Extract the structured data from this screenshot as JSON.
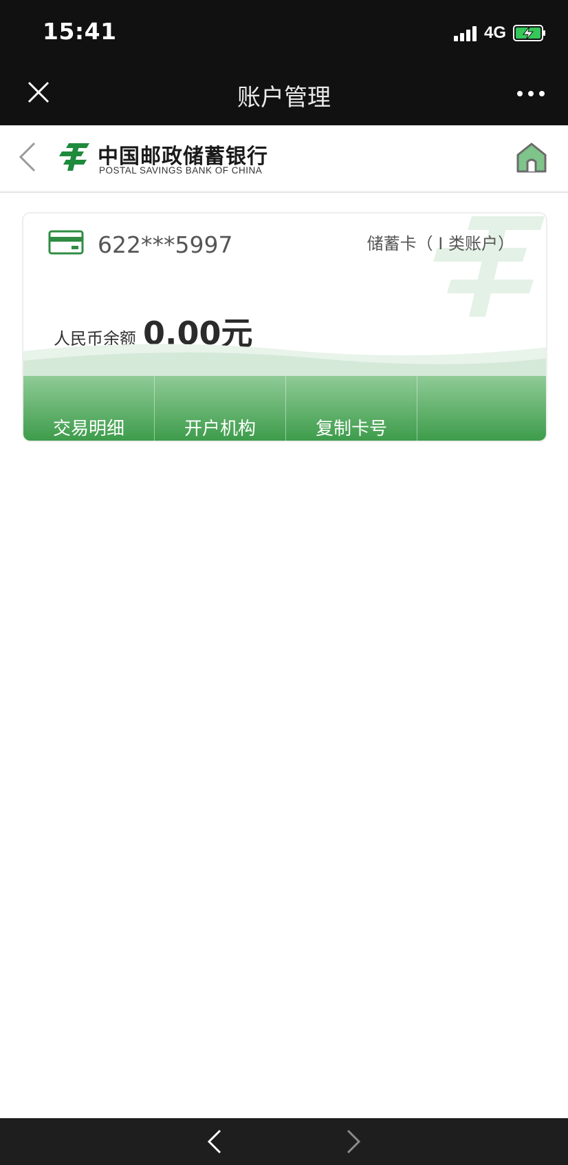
{
  "status_bar": {
    "time": "15:41",
    "network": "4G"
  },
  "nav": {
    "title": "账户管理"
  },
  "bank_header": {
    "name_cn": "中国邮政储蓄银行",
    "name_en": "POSTAL SAVINGS BANK OF CHINA"
  },
  "account_card": {
    "card_number": "622***5997",
    "card_type": "储蓄卡（ I 类账户）",
    "balance_label": "人民币余额",
    "balance_value": "0.00元",
    "actions": [
      {
        "label": "交易明细"
      },
      {
        "label": "开户机构"
      },
      {
        "label": "复制卡号"
      },
      {
        "label": ""
      }
    ]
  },
  "colors": {
    "brand_green": "#1e8a3c",
    "status_bar_bg": "#111111",
    "battery_green": "#35c759"
  },
  "icons": [
    "close-icon",
    "more-icon",
    "back-chevron-icon",
    "bank-logo-icon",
    "home-icon",
    "card-icon",
    "signal-icon",
    "battery-charging-icon",
    "nav-back-arrow-icon",
    "nav-forward-arrow-icon"
  ]
}
